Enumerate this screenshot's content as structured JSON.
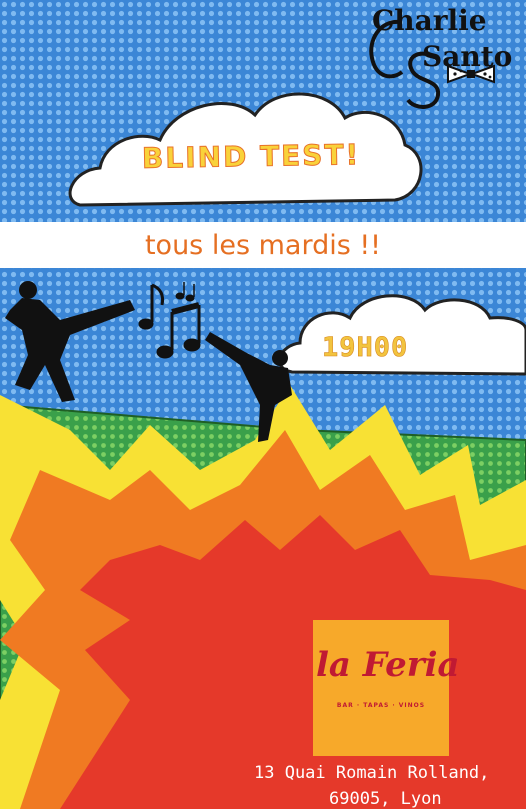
{
  "logo": {
    "line1": "Charlie",
    "line2": "Santo"
  },
  "event": {
    "title": "BLIND TEST!",
    "schedule": "tous les mardis !!",
    "time": "19H00"
  },
  "venue": {
    "name": "la Feria",
    "tagline": "BAR · TAPAS · VINOS",
    "address_line1": "13 Quai Romain Rolland,",
    "address_line2": "69005, Lyon"
  },
  "colors": {
    "sky": "#3b86d6",
    "banner": "#ffffff",
    "grass": "#3aa04a",
    "burst_outer": "#f8e134",
    "burst_mid": "#f07a22",
    "burst_inner": "#e5392a",
    "title_yellow": "#f9d23a",
    "schedule_orange": "#e56f22",
    "feria_red": "#c01a33",
    "feria_box": "#f7a92a"
  },
  "icons": [
    "music-notes-icon",
    "bow-tie-icon",
    "karate-silhouette-left-icon",
    "karate-silhouette-right-icon"
  ]
}
